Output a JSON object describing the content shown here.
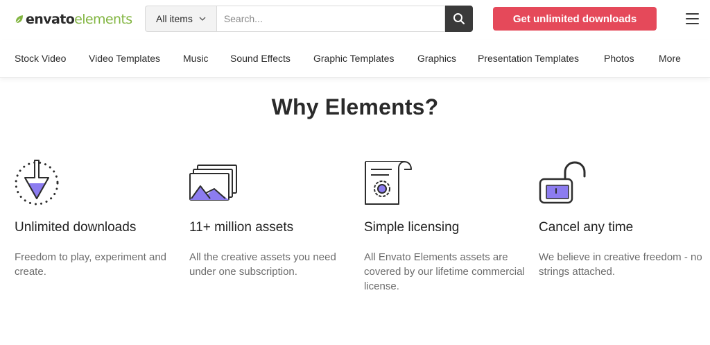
{
  "brand": {
    "logo_word_1": "envato",
    "logo_word_2": "elements",
    "leaf_color": "#82b541"
  },
  "search": {
    "category_value": "All items",
    "placeholder": "Search...",
    "value": ""
  },
  "header": {
    "cta_label": "Get unlimited downloads",
    "cta_color": "#e5495a"
  },
  "nav": {
    "items": [
      {
        "label": "Stock Video"
      },
      {
        "label": "Video Templates"
      },
      {
        "label": "Music"
      },
      {
        "label": "Sound Effects"
      },
      {
        "label": "Graphic Templates"
      },
      {
        "label": "Graphics"
      },
      {
        "label": "Presentation Templates"
      },
      {
        "label": "Photos"
      },
      {
        "label": "More"
      }
    ]
  },
  "section": {
    "heading": "Why Elements?",
    "accent_color": "#8c7cf0",
    "features": [
      {
        "icon": "download-icon",
        "title": "Unlimited downloads",
        "description": "Freedom to play, experiment and create."
      },
      {
        "icon": "image-stack-icon",
        "title": "11+ million assets",
        "description": "All the creative assets you need under one subscription."
      },
      {
        "icon": "license-certificate-icon",
        "title": "Simple licensing",
        "description": "All Envato Elements assets are covered by our lifetime commercial license."
      },
      {
        "icon": "unlocked-padlock-icon",
        "title": "Cancel any time",
        "description": "We believe in creative freedom - no strings attached."
      }
    ]
  }
}
